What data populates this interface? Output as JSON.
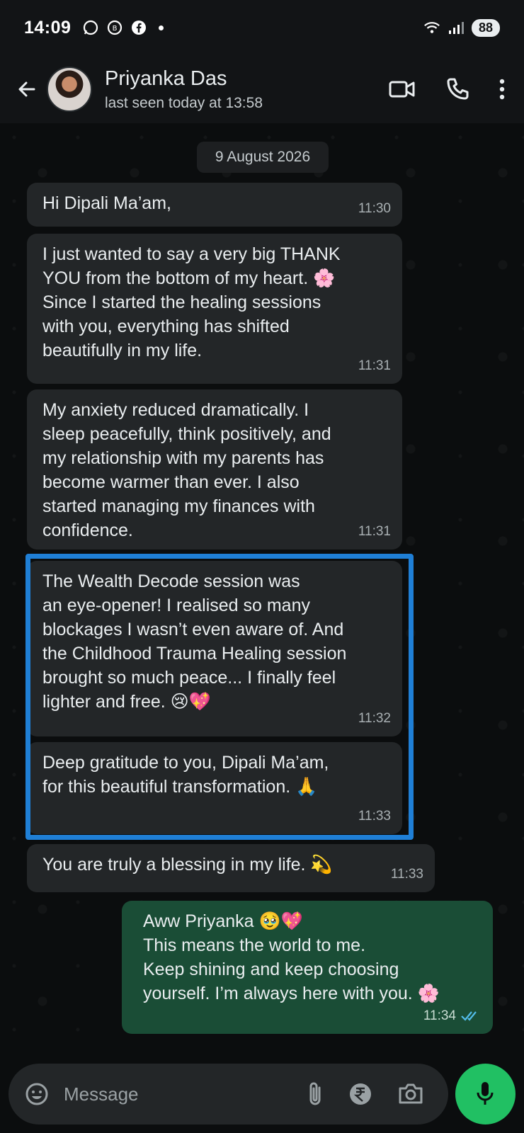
{
  "status_bar": {
    "time": "14:09",
    "battery": "88",
    "icons_left": [
      "whatsapp-icon",
      "whatsapp-business-icon",
      "facebook-icon",
      "notification-dot"
    ],
    "icons_right": [
      "wifi-icon",
      "signal-icon",
      "battery-icon"
    ]
  },
  "header": {
    "contact_name": "Priyanka Das",
    "last_seen": "last seen today at 13:58",
    "actions": [
      "video-call-icon",
      "voice-call-icon",
      "more-options-icon"
    ]
  },
  "chat": {
    "date_chip": "9 August 2026",
    "messages": [
      {
        "direction": "in",
        "lines": [
          "Hi Dipali Ma’am,"
        ],
        "time": "11:30"
      },
      {
        "direction": "in",
        "lines": [
          "I just wanted to say a very big THANK",
          "YOU from the bottom of my heart. 🌸",
          "Since I started the healing sessions",
          "with you, everything has shifted",
          "beautifully in my life."
        ],
        "time": "11:31"
      },
      {
        "direction": "in",
        "lines": [
          "My anxiety reduced dramatically. I",
          "sleep peacefully, think positively, and",
          "my relationship with my parents has",
          "become warmer than ever. I also",
          "started managing my finances with",
          "confidence."
        ],
        "time": "11:31"
      },
      {
        "direction": "in",
        "lines": [
          "The Wealth Decode session was",
          "an eye-opener! I realised so many",
          "blockages I wasn’t even aware of. And",
          "the Childhood Trauma Healing session",
          "brought so much peace... I finally feel",
          "lighter and free. 😢💖"
        ],
        "time": "11:32"
      },
      {
        "direction": "in",
        "lines": [
          "Deep gratitude to you, Dipali Ma’am,",
          "for this beautiful transformation. 🙏"
        ],
        "time": "11:33"
      },
      {
        "direction": "in",
        "lines": [
          "You are truly a blessing in my life. 💫"
        ],
        "time": "11:33"
      },
      {
        "direction": "out",
        "lines": [
          "Aww Priyanka 🥹💖",
          "This means the world to me.",
          "Keep shining and keep choosing",
          "yourself. I’m always here with you. 🌸"
        ],
        "time": "11:34",
        "status": "read"
      }
    ]
  },
  "composer": {
    "placeholder": "Message",
    "icons": [
      "emoji-icon",
      "attach-icon",
      "rupee-payment-icon",
      "camera-icon",
      "mic-icon"
    ]
  },
  "colors": {
    "incoming_bubble": "#232628",
    "outgoing_bubble": "#1a4d36",
    "highlight_border": "#1f7fd6",
    "mic_button": "#21c063",
    "read_ticks": "#53bdeb"
  }
}
